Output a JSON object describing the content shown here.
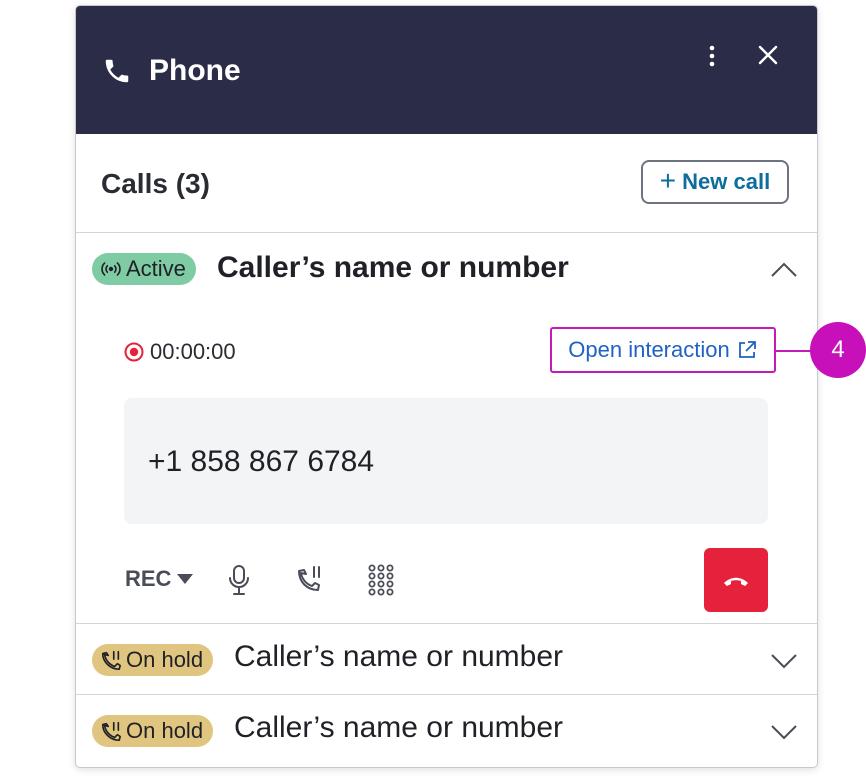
{
  "header": {
    "title": "Phone"
  },
  "calls": {
    "title": "Calls (3)",
    "new_call_label": "New call"
  },
  "active_call": {
    "status": "Active",
    "caller": "Caller’s name or number",
    "timer": "00:00:00",
    "open_interaction_label": "Open interaction",
    "number": "+1 858 867 6784",
    "rec_label": "REC"
  },
  "held_calls": [
    {
      "status": "On hold",
      "caller": "Caller’s name or number"
    },
    {
      "status": "On hold",
      "caller": "Caller’s name or number"
    }
  ],
  "callout": {
    "label": "4"
  },
  "colors": {
    "header_bg": "#2b2d48",
    "active_badge": "#7fcba3",
    "hold_badge": "#dfc580",
    "link": "#1f62c6",
    "callout": "#c710b9",
    "hangup": "#e6213c"
  },
  "icons": [
    "phone-icon",
    "more-vertical-icon",
    "close-icon",
    "plus-icon",
    "broadcast-icon",
    "chevron-up-icon",
    "record-icon",
    "external-link-icon",
    "chevron-down-icon",
    "microphone-icon",
    "transfer-call-icon",
    "keypad-icon",
    "hang-up-icon",
    "hold-icon"
  ]
}
